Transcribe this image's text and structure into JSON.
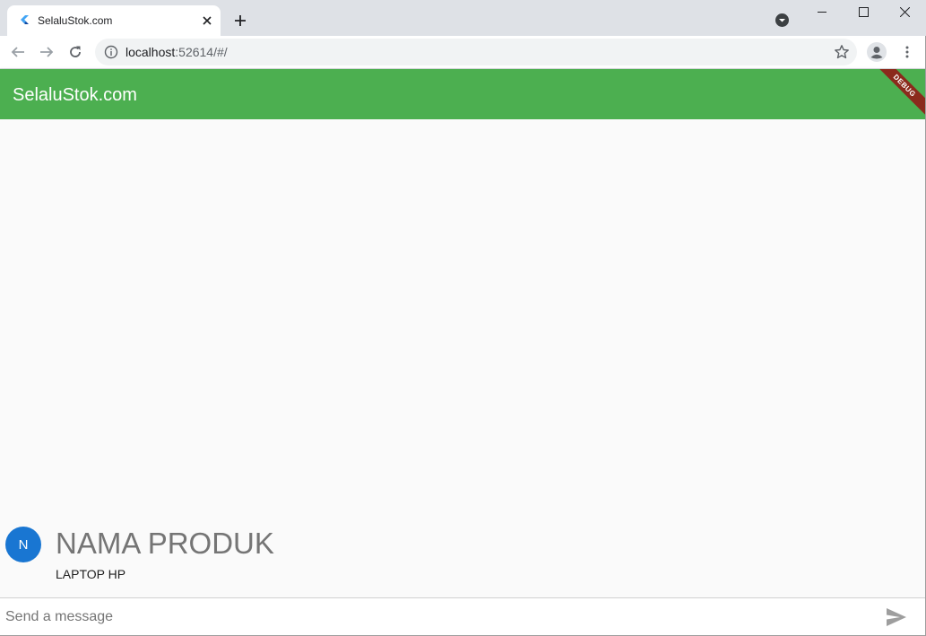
{
  "browser": {
    "tab": {
      "title": "SelaluStok.com"
    },
    "address": {
      "host": "localhost",
      "rest": ":52614/#/"
    }
  },
  "app": {
    "title": "SelaluStok.com",
    "debug_label": "DEBUG",
    "accent": "#4caf50"
  },
  "product": {
    "avatar_letter": "N",
    "title": "NAMA PRODUK",
    "subtitle": "LAPTOP HP"
  },
  "composer": {
    "placeholder": "Send a message",
    "value": ""
  },
  "icons": {
    "favicon": "flutter-icon",
    "tab_close": "close-icon",
    "new_tab": "plus-icon",
    "back": "arrow-left-icon",
    "forward": "arrow-right-icon",
    "reload": "reload-icon",
    "site_info": "info-icon",
    "bookmark": "star-icon",
    "profile": "account-icon",
    "menu": "kebab-menu-icon",
    "send": "send-icon"
  }
}
